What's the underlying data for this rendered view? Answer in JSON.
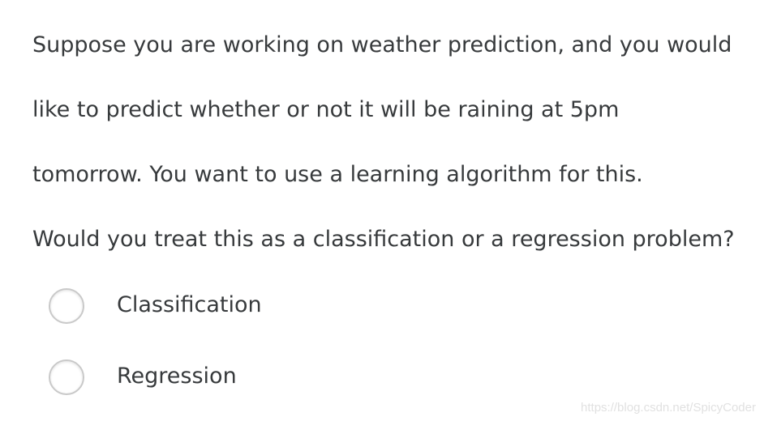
{
  "question": {
    "lines": [
      "Suppose you are working on weather prediction, and you would",
      "like to predict whether or not it will be raining at 5pm",
      "tomorrow. You want to use a learning algorithm for this.",
      "Would you treat this as a classification or a regression problem?"
    ]
  },
  "options": [
    {
      "label": "Classification",
      "selected": false,
      "icon": "radio-unchecked-icon"
    },
    {
      "label": "Regression",
      "selected": false,
      "icon": "radio-unchecked-icon"
    }
  ],
  "watermark": "https://blog.csdn.net/SpicyCoder",
  "colors": {
    "text": "#373a3c",
    "radio_border": "#c9c9c9",
    "background": "#ffffff",
    "watermark": "#e1e1e1"
  }
}
